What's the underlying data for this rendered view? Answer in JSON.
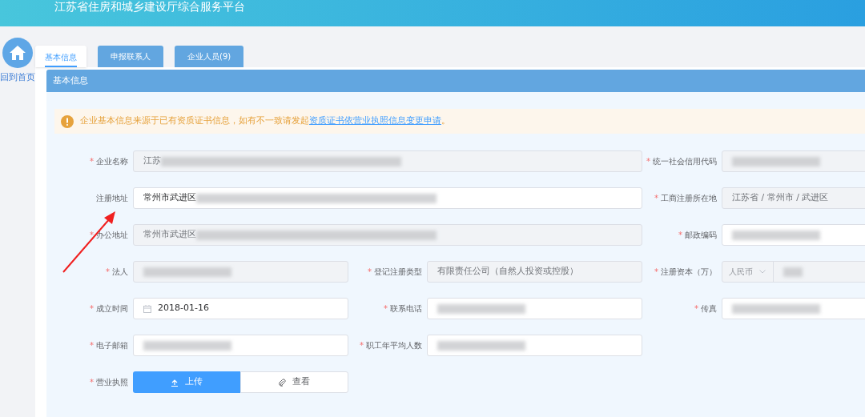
{
  "header": {
    "title": "江苏省住房和城乡建设厅综合服务平台"
  },
  "sidebar": {
    "home_label": "回到首页"
  },
  "tabs": [
    {
      "label": "基本信息",
      "selected": true
    },
    {
      "label": "申报联系人",
      "selected": false
    },
    {
      "label": "企业人员(9)",
      "selected": false
    }
  ],
  "section": {
    "title": "基本信息"
  },
  "notice": {
    "text": "企业基本信息来源于已有资质证书信息，如有不一致请发起",
    "link": "资质证书依营业执照信息变更申请",
    "suffix": "。"
  },
  "rows": [
    {
      "fields": [
        {
          "kind": "text",
          "wide": true,
          "label": "企业名称",
          "marker": "*",
          "disabled": true,
          "value": "江苏",
          "redacted": true
        },
        {
          "kind": "text",
          "wide": false,
          "label": "统一社会信用代码",
          "marker": "*",
          "disabled": true,
          "redacted": true
        }
      ]
    },
    {
      "fields": [
        {
          "kind": "text",
          "wide": true,
          "label": "注册地址",
          "disabled": false,
          "value": "常州市武进区",
          "redacted": true
        },
        {
          "kind": "text",
          "wide": false,
          "label": "工商注册所在地",
          "marker": "*",
          "disabled": true,
          "value": "江苏省 / 常州市 / 武进区"
        }
      ]
    },
    {
      "fields": [
        {
          "kind": "text",
          "wide": true,
          "label": "办公地址",
          "marker": "*",
          "disabled": true,
          "value": "常州市武进区",
          "redacted": true
        },
        {
          "kind": "text",
          "wide": false,
          "label": "邮政编码",
          "marker": "*",
          "disabled": false,
          "redacted": true
        }
      ]
    },
    {
      "fields": [
        {
          "kind": "text",
          "wide": false,
          "label": "法人",
          "marker": "*",
          "disabled": true,
          "redacted": true
        },
        {
          "kind": "text",
          "wide": false,
          "label": "登记注册类型",
          "marker": "*",
          "disabled": true,
          "value": "有限责任公司（自然人投资或控股）"
        },
        {
          "kind": "currency",
          "wide": false,
          "label": "注册资本（万）",
          "marker": "*",
          "disabled": true,
          "unit": "人民币",
          "redacted": true
        }
      ]
    },
    {
      "fields": [
        {
          "kind": "date",
          "wide": false,
          "label": "成立时间",
          "marker": "*",
          "disabled": false,
          "value": "2018-01-16"
        },
        {
          "kind": "text",
          "wide": false,
          "label": "联系电话",
          "marker": "*",
          "disabled": false,
          "redacted": true
        },
        {
          "kind": "text",
          "wide": false,
          "label": "传真",
          "marker": "*",
          "disabled": false,
          "redacted": true
        }
      ]
    },
    {
      "fields": [
        {
          "kind": "text",
          "wide": false,
          "label": "电子邮箱",
          "marker": "*",
          "disabled": false,
          "redacted": true
        },
        {
          "kind": "text",
          "wide": false,
          "label": "职工年平均人数",
          "marker": "*",
          "disabled": false,
          "redacted": true
        }
      ]
    },
    {
      "fields": [
        {
          "kind": "upload",
          "wide": false,
          "label": "营业执照",
          "marker": "*",
          "upload": "上传",
          "view": "查看"
        }
      ]
    }
  ]
}
